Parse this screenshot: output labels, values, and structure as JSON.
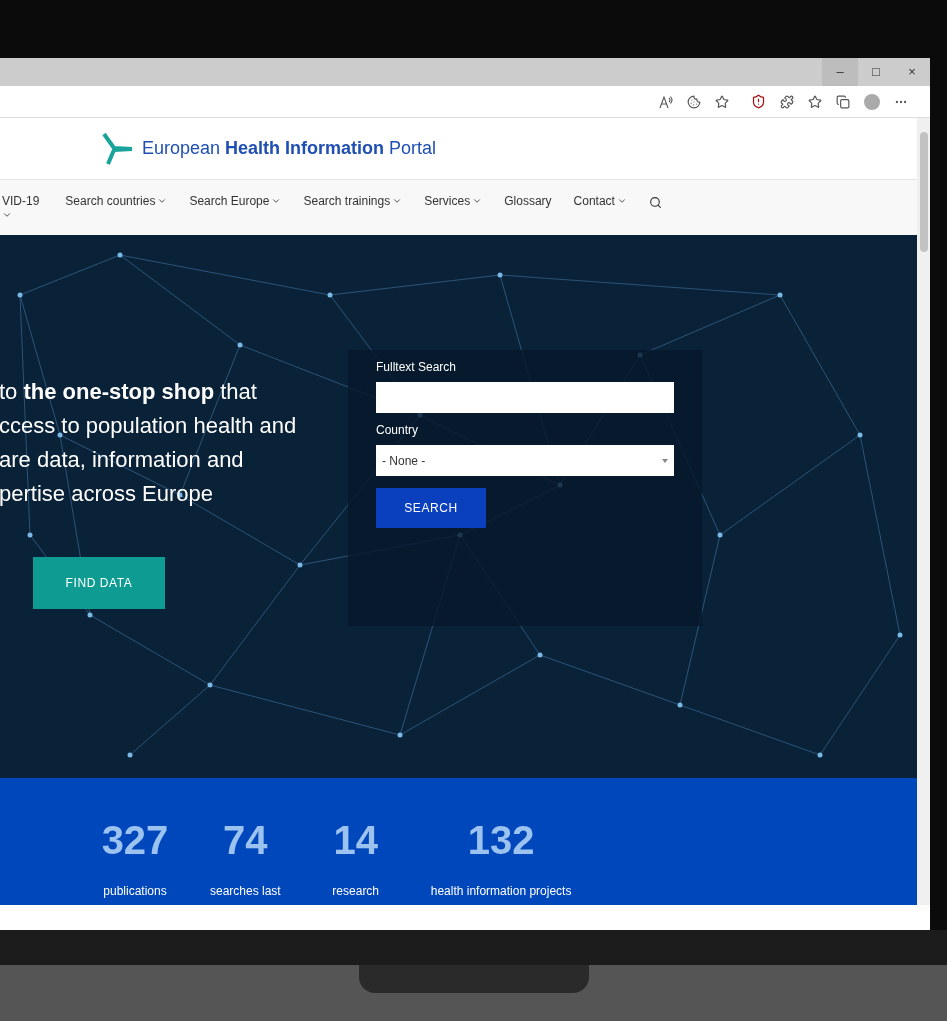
{
  "window": {
    "controls": [
      "–",
      "□",
      "×"
    ]
  },
  "site": {
    "title": "European **Health Information** Portal"
  },
  "nav": [
    {
      "label": "VID-19",
      "dropdown": true,
      "stacked": true
    },
    {
      "label": "Search countries",
      "dropdown": true,
      "stacked": false
    },
    {
      "label": "Search Europe",
      "dropdown": true,
      "stacked": false
    },
    {
      "label": "Search trainings",
      "dropdown": true,
      "stacked": false
    },
    {
      "label": "Services",
      "dropdown": true,
      "stacked": false
    },
    {
      "label": "Glossary",
      "dropdown": false,
      "stacked": false
    },
    {
      "label": "Contact",
      "dropdown": true,
      "stacked": false
    }
  ],
  "hero": {
    "lines": [
      "to **the one-stop shop** that",
      "ccess to population health and",
      "are data, information and",
      "pertise across Europe"
    ],
    "button": "FIND DATA"
  },
  "search_form": {
    "fulltext_label": "Fulltext Search",
    "country_label": "Country",
    "country_value": "- None -",
    "button": "SEARCH"
  },
  "stats": [
    {
      "value": "327",
      "label": "publications"
    },
    {
      "value": "74",
      "label": "searches last"
    },
    {
      "value": "14",
      "label": "research"
    },
    {
      "value": "132",
      "label": "health information projects"
    }
  ]
}
